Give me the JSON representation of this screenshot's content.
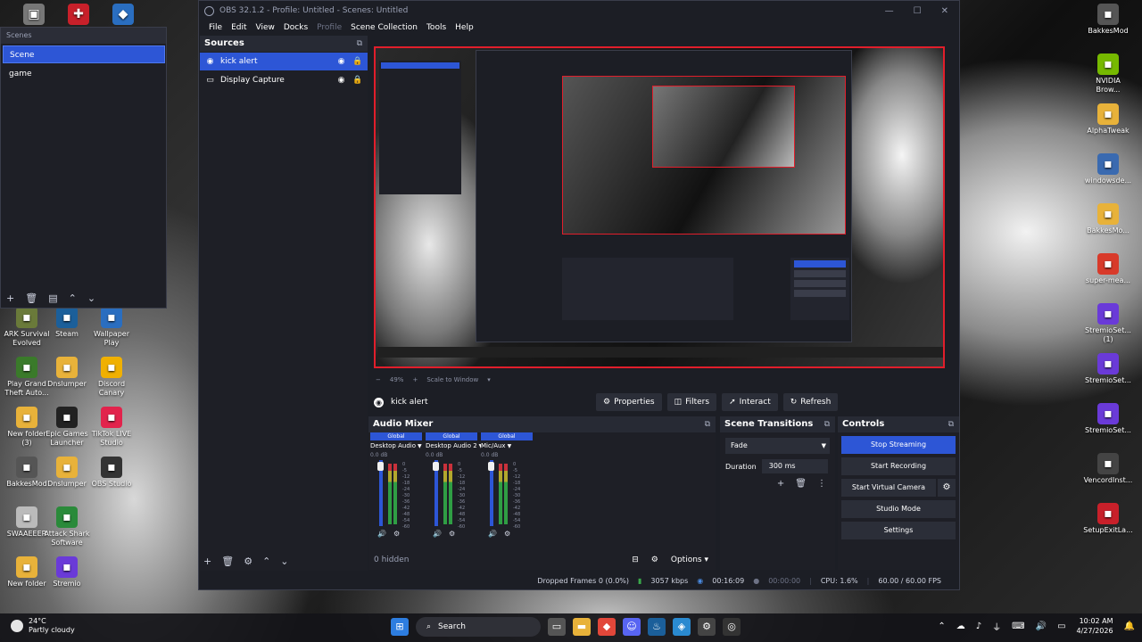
{
  "desktop_left": [
    {
      "label": "ARK Survival Evolved",
      "icon": "ark-icon",
      "color": "#6a7a3a"
    },
    {
      "label": "Steam",
      "icon": "steam-icon",
      "color": "#1b5f9a"
    },
    {
      "label": "Wallpaper Play",
      "icon": "wallpaper-icon",
      "color": "#2a6ec0"
    },
    {
      "label": "Play Grand Theft Auto...",
      "icon": "gta-icon",
      "color": "#3a7a2a"
    },
    {
      "label": "Dnslumper",
      "icon": "folder-icon",
      "color": "#e8b23a"
    },
    {
      "label": "Discord Canary",
      "icon": "discord-icon",
      "color": "#f0b000"
    },
    {
      "label": "New folder (3)",
      "icon": "folder-icon",
      "color": "#e8b23a"
    },
    {
      "label": "Epic Games Launcher",
      "icon": "epic-icon",
      "color": "#222222"
    },
    {
      "label": "TikTok LIVE Studio",
      "icon": "tiktok-icon",
      "color": "#e2234c"
    },
    {
      "label": "BakkesMod",
      "icon": "bakkesmod-icon",
      "color": "#555555"
    },
    {
      "label": "Dnslumper",
      "icon": "folder-icon",
      "color": "#e8b23a"
    },
    {
      "label": "OBS Studio",
      "icon": "obs-icon",
      "color": "#333333"
    },
    {
      "label": "SWAAEEER",
      "icon": "file-icon",
      "color": "#bbbbbb"
    },
    {
      "label": "Attack Shark Software",
      "icon": "shark-icon",
      "color": "#2a8a3a"
    },
    {
      "label": "New folder",
      "icon": "folder-icon",
      "color": "#e8b23a"
    },
    {
      "label": "Stremio",
      "icon": "stremio-icon",
      "color": "#6a3ad8"
    }
  ],
  "desktop_right": [
    {
      "label": "BakkesMod",
      "icon": "bakkesmod-icon",
      "color": "#555555"
    },
    {
      "label": "NVIDIA Brow...",
      "icon": "nvidia-icon",
      "color": "#76b900"
    },
    {
      "label": "AlphaTweak",
      "icon": "folder-icon",
      "color": "#e8b23a"
    },
    {
      "label": "windowsde...",
      "icon": "windows-icon",
      "color": "#3a6ab0"
    },
    {
      "label": "BakkesMo...",
      "icon": "folder-icon",
      "color": "#e8b23a"
    },
    {
      "label": "super-mea...",
      "icon": "app-icon",
      "color": "#d83a2a"
    },
    {
      "label": "StremioSet... (1)",
      "icon": "stremio-icon",
      "color": "#6a3ad8"
    },
    {
      "label": "StremioSet...",
      "icon": "stremio-icon",
      "color": "#6a3ad8"
    },
    {
      "label": "StremioSet...",
      "icon": "stremio-icon",
      "color": "#6a3ad8"
    },
    {
      "label": "VencordInst...",
      "icon": "vencord-icon",
      "color": "#444444"
    },
    {
      "label": "SetupExitLa...",
      "icon": "setup-icon",
      "color": "#c8202a"
    }
  ],
  "scenes": {
    "title": "Scenes",
    "items": [
      "Scene",
      "game"
    ],
    "selected": 0
  },
  "obs": {
    "title": "OBS 32.1.2 - Profile: Untitled - Scenes: Untitled",
    "menu": [
      "File",
      "Edit",
      "View",
      "Docks",
      "Profile",
      "Scene Collection",
      "Tools",
      "Help"
    ],
    "menu_dim": [
      false,
      false,
      false,
      false,
      true,
      false,
      false,
      false
    ],
    "sources_title": "Sources",
    "sources": [
      {
        "name": "kick alert",
        "icon": "browser-source-icon",
        "selected": true
      },
      {
        "name": "Display Capture",
        "icon": "display-capture-icon",
        "selected": false
      }
    ],
    "preview_zoom": "49%",
    "preview_scale": "Scale to Window",
    "context": {
      "source": "kick alert",
      "properties": "Properties",
      "filters": "Filters",
      "interact": "Interact",
      "refresh": "Refresh"
    },
    "audio_mixer": {
      "title": "Audio Mixer",
      "channels": [
        {
          "badge": "Global",
          "name": "Desktop Audio",
          "db": "0.0 dB"
        },
        {
          "badge": "Global",
          "name": "Desktop Audio 2",
          "db": "0.0 dB"
        },
        {
          "badge": "Global",
          "name": "Mic/Aux",
          "db": "0.0 dB"
        }
      ],
      "scale": [
        "0",
        "-5",
        "-12",
        "-18",
        "-24",
        "-30",
        "-36",
        "-42",
        "-48",
        "-54",
        "-60"
      ],
      "hidden": "0 hidden",
      "options": "Options"
    },
    "transitions": {
      "title": "Scene Transitions",
      "selected": "Fade",
      "duration_label": "Duration",
      "duration_value": "300 ms"
    },
    "controls": {
      "title": "Controls",
      "stop_streaming": "Stop Streaming",
      "start_recording": "Start Recording",
      "start_virtual_camera": "Start Virtual Camera",
      "studio_mode": "Studio Mode",
      "settings": "Settings"
    },
    "status": {
      "dropped_frames": "Dropped Frames 0 (0.0%)",
      "bitrate": "3057 kbps",
      "stream_time": "00:16:09",
      "record_time": "00:00:00",
      "cpu": "CPU: 1.6%",
      "fps": "60.00 / 60.00 FPS"
    }
  },
  "taskbar": {
    "temperature": "24°C",
    "weather": "Partly cloudy",
    "search_placeholder": "Search",
    "time": "10:02 AM",
    "date": "4/27/2026"
  },
  "colors": {
    "accent": "#2d56d6",
    "preview_border": "#e11e2b",
    "panel_bg": "#1e1f26",
    "window_bg": "#1c1e25"
  }
}
